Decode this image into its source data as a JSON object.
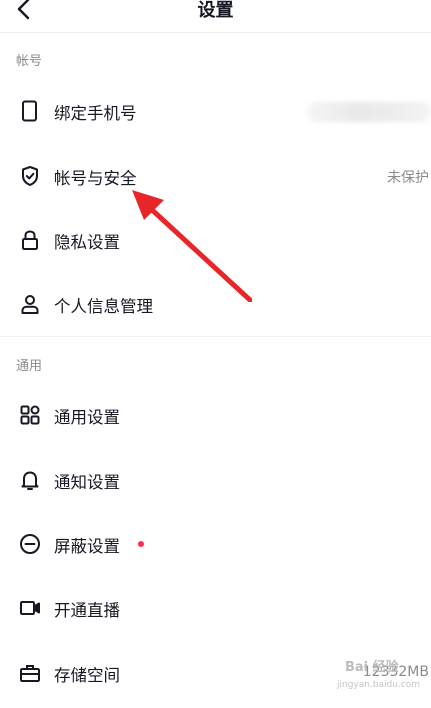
{
  "header": {
    "title": "设置"
  },
  "sections": [
    {
      "label": "帐号"
    },
    {
      "label": "通用"
    }
  ],
  "account_items": [
    {
      "label": "绑定手机号",
      "icon": "phone-icon"
    },
    {
      "label": "帐号与安全",
      "value": "未保护",
      "icon": "shield-check-icon"
    },
    {
      "label": "隐私设置",
      "icon": "lock-icon"
    },
    {
      "label": "个人信息管理",
      "icon": "person-icon"
    }
  ],
  "general_items": [
    {
      "label": "通用设置",
      "icon": "grid-icon"
    },
    {
      "label": "通知设置",
      "icon": "bell-icon"
    },
    {
      "label": "屏蔽设置",
      "icon": "minus-circle-icon",
      "badge_color": "#fe2c55"
    },
    {
      "label": "开通直播",
      "icon": "video-camera-icon"
    },
    {
      "label": "存储空间",
      "value": "12332MB",
      "icon": "toolbox-icon"
    }
  ],
  "watermark": {
    "text": "Bai 经验",
    "sub": "jingyan.baidu.com"
  },
  "colors": {
    "annotation_arrow": "#e8262a",
    "badge": "#fe2c55"
  }
}
